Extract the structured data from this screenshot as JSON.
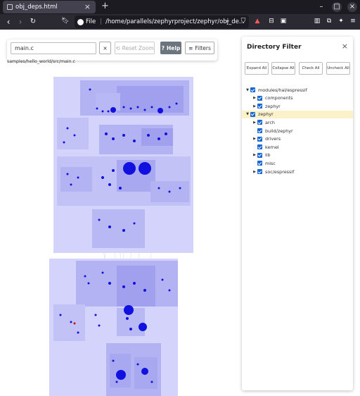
{
  "browser": {
    "tab_title": "obj_deps.html",
    "url_scheme": "File",
    "url_path": "/home/parallels/zephyrproject/zephyr/obj_de..."
  },
  "controls": {
    "search_value": "main.c",
    "clear_label": "×",
    "reset_zoom_label": "Reset Zoom",
    "help_label": "Help",
    "filters_label": "Filters"
  },
  "file_path": "samples/hello_world/src/main.c",
  "directory_filter": {
    "title": "Directory Filter",
    "buttons": {
      "expand_all": "Expand All",
      "collapse_all": "Collapse All",
      "check_all": "Check All",
      "uncheck_all": "Uncheck All"
    },
    "tree": [
      {
        "label": "modules/hal/espressif",
        "level": 0,
        "expanded": true,
        "has_children": true,
        "checked": true
      },
      {
        "label": "components",
        "level": 1,
        "expanded": false,
        "has_children": true,
        "checked": true
      },
      {
        "label": "zephyr",
        "level": 1,
        "expanded": false,
        "has_children": true,
        "checked": true
      },
      {
        "label": "zephyr",
        "level": 0,
        "expanded": true,
        "has_children": true,
        "checked": true,
        "highlighted": true
      },
      {
        "label": "arch",
        "level": 1,
        "expanded": false,
        "has_children": true,
        "checked": true
      },
      {
        "label": "build/zephyr",
        "level": 1,
        "expanded": false,
        "has_children": false,
        "checked": true
      },
      {
        "label": "drivers",
        "level": 1,
        "expanded": false,
        "has_children": true,
        "checked": true
      },
      {
        "label": "kernel",
        "level": 1,
        "expanded": false,
        "has_children": false,
        "checked": true
      },
      {
        "label": "lib",
        "level": 1,
        "expanded": false,
        "has_children": true,
        "checked": true
      },
      {
        "label": "misc",
        "level": 1,
        "expanded": false,
        "has_children": false,
        "checked": true
      },
      {
        "label": "soc/espressif",
        "level": 1,
        "expanded": false,
        "has_children": true,
        "checked": true
      }
    ]
  },
  "colors": {
    "accent": "#1967d2",
    "cluster_fill": "#d3d3fb",
    "node": "#1010e0",
    "highlight_row": "#fcf2c9"
  }
}
